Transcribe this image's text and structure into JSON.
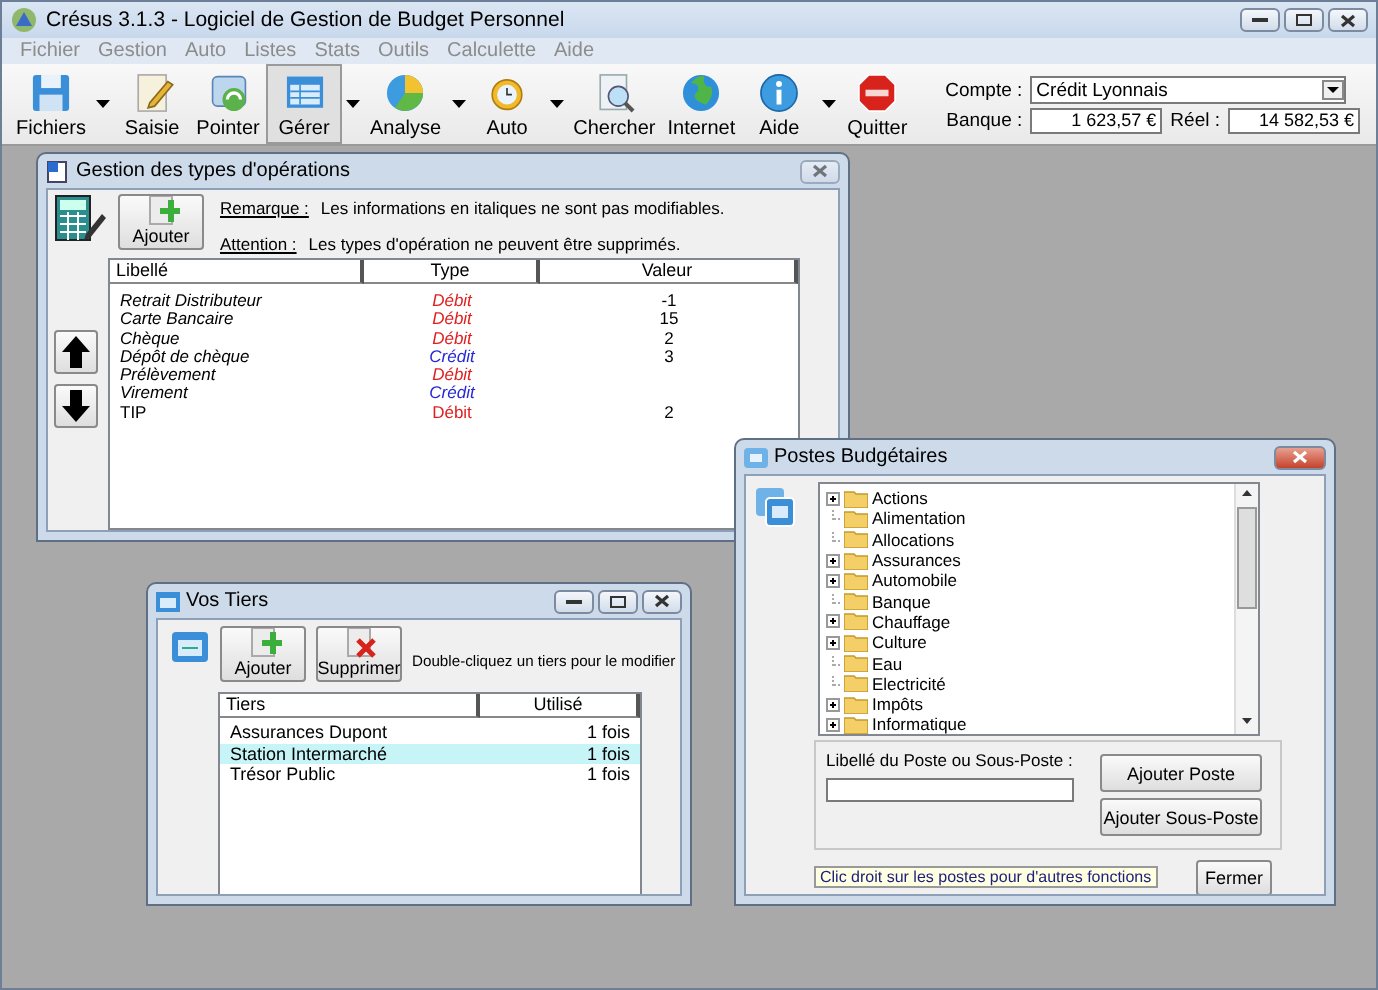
{
  "window": {
    "title": "Crésus 3.1.3 - Logiciel de Gestion de Budget Personnel"
  },
  "menu": [
    {
      "label": "Fichier",
      "disabled": true
    },
    {
      "label": "Gestion",
      "disabled": true
    },
    {
      "label": "Auto",
      "disabled": true
    },
    {
      "label": "Listes",
      "disabled": true
    },
    {
      "label": "Stats",
      "disabled": true
    },
    {
      "label": "Outils",
      "disabled": true
    },
    {
      "label": "Calculette",
      "disabled": true
    },
    {
      "label": "Aide",
      "disabled": true
    }
  ],
  "toolbar": [
    {
      "label": "Fichiers",
      "has_menu": true,
      "selected": false
    },
    {
      "label": "Saisie",
      "has_menu": false,
      "selected": false
    },
    {
      "label": "Pointer",
      "has_menu": false,
      "selected": false
    },
    {
      "label": "Gérer",
      "has_menu": true,
      "selected": true
    },
    {
      "label": "Analyse",
      "has_menu": true,
      "selected": false
    },
    {
      "label": "Auto",
      "has_menu": true,
      "selected": false
    },
    {
      "label": "Chercher",
      "has_menu": false,
      "selected": false
    },
    {
      "label": "Internet",
      "has_menu": false,
      "selected": false
    },
    {
      "label": "Aide",
      "has_menu": true,
      "selected": false
    },
    {
      "label": "Quitter",
      "has_menu": false,
      "selected": false
    }
  ],
  "account": {
    "compte_label": "Compte :",
    "compte": "Crédit Lyonnais",
    "banque_label": "Banque :",
    "banque": "1 623,57 €",
    "reel_label": "Réel :",
    "reel": "14 582,53 €"
  },
  "types_window": {
    "title": "Gestion des types d'opérations",
    "active": false,
    "add_button": "Ajouter",
    "notes": [
      {
        "label": "Remarque :",
        "text": "Les informations en italiques ne sont pas modifiables."
      },
      {
        "label": "Attention :",
        "text": "Les types d'opération ne peuvent être supprimés."
      }
    ],
    "columns": [
      "Libellé",
      "Type",
      "Valeur"
    ],
    "rows": [
      {
        "label": "Retrait Distributeur",
        "editable": false,
        "type": "Débit",
        "kind": "debit",
        "value": "-1"
      },
      {
        "label": "Carte Bancaire",
        "editable": false,
        "type": "Débit",
        "kind": "debit",
        "value": "15"
      },
      {
        "label": "Chèque",
        "editable": false,
        "type": "Débit",
        "kind": "debit",
        "value": "2"
      },
      {
        "label": "Dépôt de chèque",
        "editable": false,
        "type": "Crédit",
        "kind": "credit",
        "value": "3"
      },
      {
        "label": "Prélèvement",
        "editable": false,
        "type": "Débit",
        "kind": "debit"
      },
      {
        "label": "Virement",
        "editable": false,
        "type": "Crédit",
        "kind": "credit"
      },
      {
        "label": "TIP",
        "editable": true,
        "type": "Débit",
        "kind": "debit",
        "value": "2"
      }
    ]
  },
  "tiers_window": {
    "title": "Vos Tiers",
    "active": false,
    "buttons": [
      "Ajouter",
      "Supprimer"
    ],
    "hint": "Double-cliquez un tiers pour le modifier",
    "columns": [
      "Tiers",
      "Utilisé"
    ],
    "rows": [
      {
        "name": "Assurances Dupont",
        "count": "1 fois",
        "selected": false
      },
      {
        "name": "Station Intermarché",
        "count": "1 fois",
        "selected": true
      },
      {
        "name": "Trésor Public",
        "count": "1 fois",
        "selected": false
      }
    ]
  },
  "postes_window": {
    "title": "Postes Budgétaires",
    "active": true,
    "tree": [
      {
        "label": "Actions",
        "expandable": true
      },
      {
        "label": "Alimentation",
        "expandable": false
      },
      {
        "label": "Allocations",
        "expandable": false
      },
      {
        "label": "Assurances",
        "expandable": true
      },
      {
        "label": "Automobile",
        "expandable": true
      },
      {
        "label": "Banque",
        "expandable": false
      },
      {
        "label": "Chauffage",
        "expandable": true
      },
      {
        "label": "Culture",
        "expandable": true
      },
      {
        "label": "Eau",
        "expandable": false
      },
      {
        "label": "Electricité",
        "expandable": false
      },
      {
        "label": "Impôts",
        "expandable": true
      },
      {
        "label": "Informatique",
        "expandable": true
      }
    ],
    "field_label": "Libellé du Poste ou Sous-Poste :",
    "buttons": [
      "Ajouter Poste",
      "Ajouter Sous-Poste"
    ],
    "hint": "Clic droit sur les postes pour d'autres fonctions",
    "close_button": "Fermer"
  }
}
